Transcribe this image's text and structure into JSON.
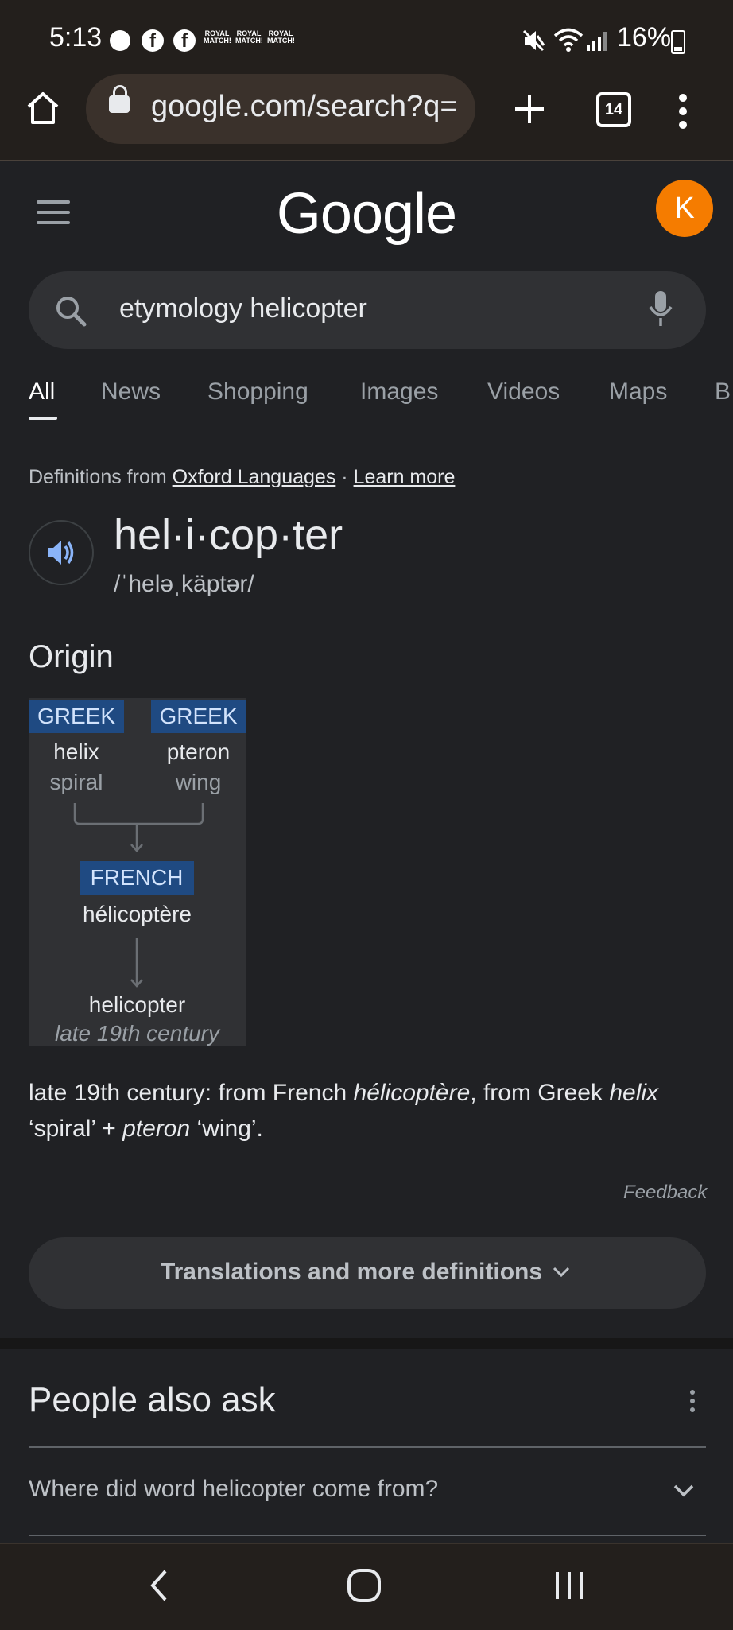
{
  "status_bar": {
    "time": "5:13",
    "notification_icons": [
      "signal-messenger-icon",
      "facebook-icon",
      "facebook-icon",
      "royal-match-icon",
      "royal-match-icon",
      "royal-match-icon"
    ],
    "royal_match_label_line1": "ROYAL",
    "royal_match_label_line2": "MATCH!",
    "battery": "16%"
  },
  "browser": {
    "url": "google.com/search?q=",
    "tab_count": "14"
  },
  "header": {
    "logo": "Google",
    "avatar_initial": "K",
    "avatar_color": "#f57c00"
  },
  "search": {
    "query": "etymology helicopter"
  },
  "tabs": {
    "all": "All",
    "news": "News",
    "shopping": "Shopping",
    "images": "Images",
    "videos": "Videos",
    "maps": "Maps",
    "partial": "B"
  },
  "definition": {
    "source_prefix": "Definitions from",
    "source_link": "Oxford Languages",
    "separator": " · ",
    "learn_more": "Learn more",
    "word": "hel·i·cop·ter",
    "phonetic": "/ˈheləˌkäptər/"
  },
  "origin": {
    "title": "Origin",
    "diagram": {
      "left_lang": "GREEK",
      "left_word": "helix",
      "left_meaning": "spiral",
      "right_lang": "GREEK",
      "right_word": "pteron",
      "right_meaning": "wing",
      "mid_lang": "FRENCH",
      "mid_word": "hélicoptère",
      "final_word": "helicopter",
      "final_date": "late 19th century"
    },
    "text": {
      "part1": "late 19th century: from French ",
      "part2": "hélicoptère",
      "part3": ", from Greek ",
      "part4": "helix",
      "part5": " ‘spiral’ + ",
      "part6": "pteron",
      "part7": " ‘wing’."
    },
    "feedback": "Feedback"
  },
  "more_button": "Translations and more definitions",
  "people_also_ask": {
    "title": "People also ask",
    "questions": [
      "Where did word helicopter come from?"
    ]
  },
  "colors": {
    "background": "#202124",
    "chrome": "#231f1c",
    "surface": "#303134",
    "lang_tag": "#1f4a82",
    "accent_blue": "#8ab4f8"
  }
}
